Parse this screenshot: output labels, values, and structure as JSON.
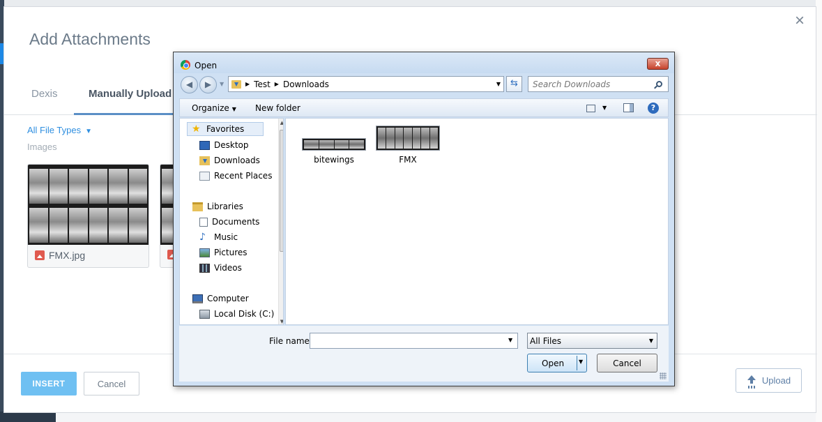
{
  "modal": {
    "title": "Add Attachments",
    "close_icon": "×",
    "tabs": [
      {
        "label": "Dexis"
      },
      {
        "label": "Manually Upload"
      }
    ],
    "filter_label": "All File Types",
    "section_label": "Images",
    "images": [
      {
        "name": "FMX.jpg",
        "icon": "image-icon"
      }
    ],
    "insert_label": "INSERT",
    "cancel_label": "Cancel",
    "upload_label": "Upload",
    "accent_color": "#2f8fe0",
    "insert_color": "#6fc0f2"
  },
  "dialog": {
    "title": "Open",
    "close_label": "x",
    "breadcrumb": [
      "Test",
      "Downloads"
    ],
    "search_placeholder": "Search Downloads",
    "organize_label": "Organize",
    "new_folder_label": "New folder",
    "help_label": "?",
    "nav": {
      "favorites_label": "Favorites",
      "favorites": [
        "Desktop",
        "Downloads",
        "Recent Places"
      ],
      "libraries_label": "Libraries",
      "libraries": [
        "Documents",
        "Music",
        "Pictures",
        "Videos"
      ],
      "computer_label": "Computer",
      "drives": [
        "Local Disk (C:)"
      ]
    },
    "files": [
      {
        "name": "bitewings"
      },
      {
        "name": "FMX"
      }
    ],
    "file_name_label": "File name:",
    "file_name_value": "",
    "file_type": "All Files",
    "open_label": "Open",
    "cancel_label": "Cancel"
  }
}
